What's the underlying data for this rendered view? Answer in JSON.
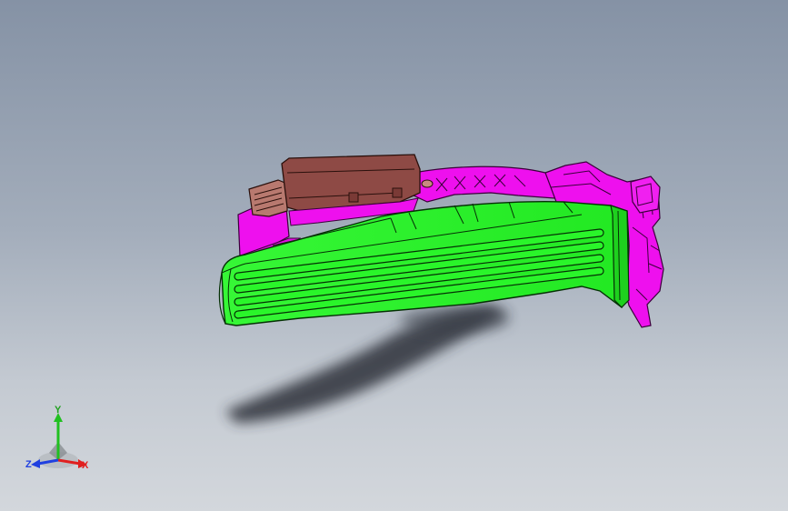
{
  "viewport": {
    "background_top": "#8592a5",
    "background_bottom": "#d3d7dc"
  },
  "model": {
    "parts": [
      {
        "name": "pedal-arm",
        "color": "#2af52a"
      },
      {
        "name": "housing",
        "color": "#ee10ee"
      },
      {
        "name": "sensor-module",
        "color": "#8e4a45"
      }
    ],
    "shadow_color": "#3a3f48"
  },
  "triad": {
    "x_label": "X",
    "y_label": "Y",
    "z_label": "Z",
    "x_color": "#e02020",
    "y_color": "#20c020",
    "z_color": "#2040e0"
  }
}
